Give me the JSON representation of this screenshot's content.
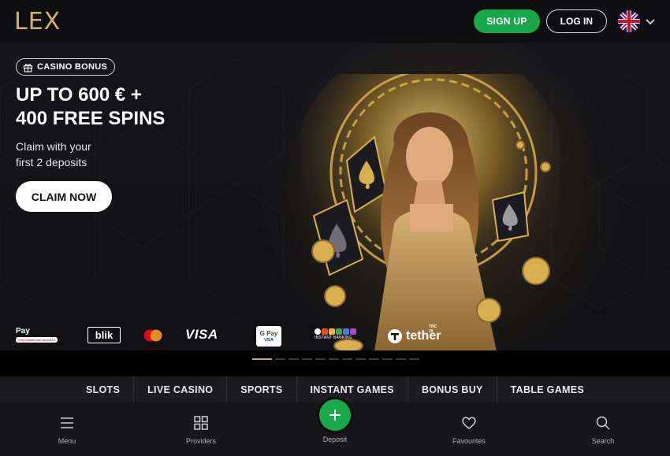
{
  "header": {
    "logo": "LEX",
    "signup_label": "SIGN UP",
    "login_label": "LOG IN",
    "language": "English (UK flag)"
  },
  "hero": {
    "badge": "CASINO BONUS",
    "headline_line1": "UP TO 600 € +",
    "headline_line2": "400 FREE SPINS",
    "sub_line1": "Claim with your",
    "sub_line2": "first 2 deposits",
    "cta": "CLAIM NOW"
  },
  "payments": {
    "apple_pay": "Pay",
    "apple_pay_note": "Only Mastercard accepted",
    "blik": "blik",
    "visa": "VISA",
    "gpay_top": "G Pay",
    "gpay_bottom": "VISA",
    "instant_banking": "INSTANT BANKING",
    "tether": "tether",
    "tether_tag": "TRC 20"
  },
  "carousel": {
    "slide_count": 12,
    "active_index": 0
  },
  "categories": [
    "SLOTS",
    "LIVE CASINO",
    "SPORTS",
    "INSTANT GAMES",
    "BONUS BUY",
    "TABLE GAMES"
  ],
  "bottom_nav": {
    "menu": "Menu",
    "providers": "Providers",
    "deposit": "Deposit",
    "favourites": "Favourites",
    "search": "Search"
  },
  "colors": {
    "accent_green": "#18a84a",
    "gold": "#d4b06a",
    "background": "#121215"
  },
  "icons": [
    "gift-icon",
    "uk-flag-icon",
    "chevron-down-icon",
    "hamburger-icon",
    "grid-icon",
    "plus-icon",
    "heart-icon",
    "search-icon"
  ]
}
